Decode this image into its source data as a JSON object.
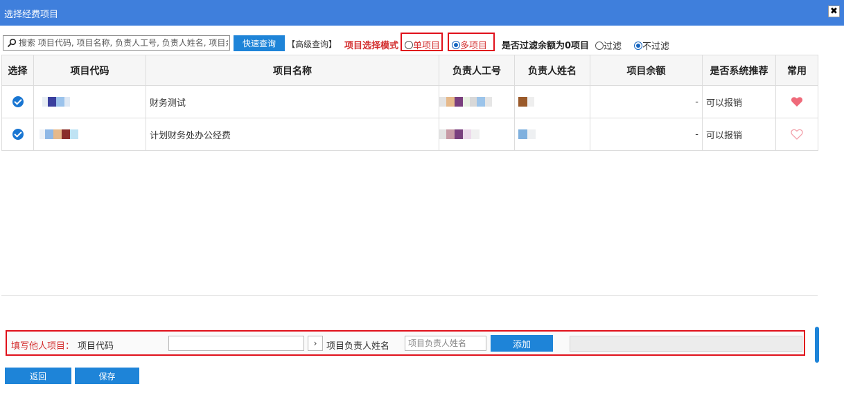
{
  "window": {
    "title": "选择经费项目",
    "close_glyph": "✖"
  },
  "toolbar": {
    "search_placeholder": "搜索 项目代码, 项目名称, 负责人工号, 负责人姓名, 项目余额",
    "quick_search_label": "快速查询",
    "advanced_search_label": "【高级查询】",
    "mode_label": "项目选择模式",
    "mode_options": [
      {
        "label": "单项目",
        "selected": false
      },
      {
        "label": "多项目",
        "selected": true
      }
    ],
    "filter_label": "是否过滤余额为0项目",
    "filter_options": [
      {
        "label": "过滤",
        "selected": false
      },
      {
        "label": "不过滤",
        "selected": true
      }
    ]
  },
  "table": {
    "columns": [
      "选择",
      "项目代码",
      "项目名称",
      "负责人工号",
      "负责人姓名",
      "项目余额",
      "是否系统推荐",
      "常用"
    ],
    "rows": [
      {
        "selected": true,
        "name": "财务测试",
        "balance": "-",
        "recommended": "可以报销",
        "favorite": true
      },
      {
        "selected": true,
        "name": "计划财务处办公经费",
        "balance": "-",
        "recommended": "可以报销",
        "favorite": false
      }
    ]
  },
  "other_project": {
    "section_label": "填写他人项目：",
    "code_label": "项目代码",
    "code_value": "",
    "arrow_glyph": "›",
    "manager_label": "项目负责人姓名",
    "manager_placeholder": "项目负责人姓名",
    "add_label": "添加"
  },
  "footer": {
    "back_label": "返回",
    "save_label": "保存"
  },
  "colors": {
    "titlebar": "#3f7fdc",
    "accent": "#1e84d8",
    "highlight_border": "#e0101a",
    "heart_full": "#ef6a7a",
    "heart_outline": "#f2a0aa"
  },
  "icons": {
    "search": "search-icon",
    "check": "check-circle-icon",
    "heart": "heart-icon",
    "close": "close-icon"
  }
}
